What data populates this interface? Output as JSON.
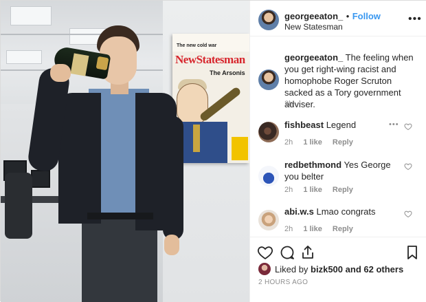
{
  "post": {
    "author": "georgeeaton_",
    "separator": "•",
    "follow_label": "Follow",
    "location": "New Statesman",
    "more_label": "•••"
  },
  "photo": {
    "poster": {
      "kicker": "The new cold war",
      "masthead": "NewStatesman",
      "headline": "The Arsonis"
    }
  },
  "comments": [
    {
      "username": "georgeeaton_",
      "text": "The feeling when you get right-wing racist and homophobe Roger Scruton sacked as a Tory government adviser.",
      "time": "2h"
    },
    {
      "username": "fishbeast",
      "text": "Legend",
      "time": "2h",
      "likes": "1 like",
      "reply": "Reply",
      "more": "•••"
    },
    {
      "username": "redbethmond",
      "text": "Yes George you belter",
      "time": "2h",
      "likes": "1 like",
      "reply": "Reply"
    },
    {
      "username": "abi.w.s",
      "text": "Lmao congrats",
      "time": "2h",
      "likes": "1 like",
      "reply": "Reply"
    }
  ],
  "footer": {
    "liked_prefix": "Liked by ",
    "liked_user": "bizk500",
    "liked_suffix": " and 62 others",
    "timestamp": "2 HOURS AGO"
  },
  "icons": {
    "like": "heart-icon",
    "comment": "comment-icon",
    "share": "share-icon",
    "save": "bookmark-icon",
    "comment_like": "heart-icon",
    "more": "more-icon"
  },
  "colors": {
    "link_blue": "#3897f0",
    "text": "#262626",
    "muted": "#8e8e8e",
    "border": "#dbdbdb"
  }
}
